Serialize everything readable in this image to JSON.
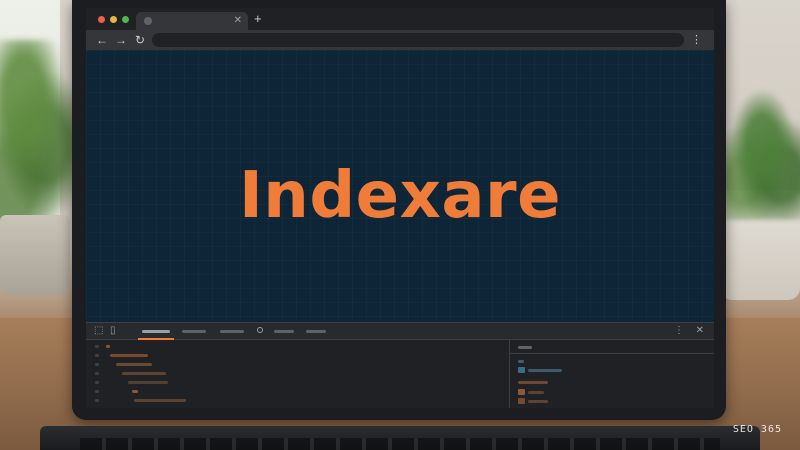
{
  "browser": {
    "window_controls": [
      "close",
      "minimize",
      "maximize"
    ],
    "tab": {
      "favicon": "globe-icon",
      "close_glyph": "✕"
    },
    "new_tab_glyph": "+",
    "toolbar": {
      "back_glyph": "←",
      "forward_glyph": "→",
      "reload_glyph": "↻",
      "menu_glyph": "⋮"
    }
  },
  "page": {
    "hero_title": "Indexare",
    "accent_color": "#f07c3a",
    "background_color": "#0d2536"
  },
  "devtools": {
    "inspect_glyph": "⬚",
    "device_glyph": "▯",
    "kebab_glyph": "⋮",
    "close_glyph": "✕"
  },
  "watermark": "SEO 365"
}
